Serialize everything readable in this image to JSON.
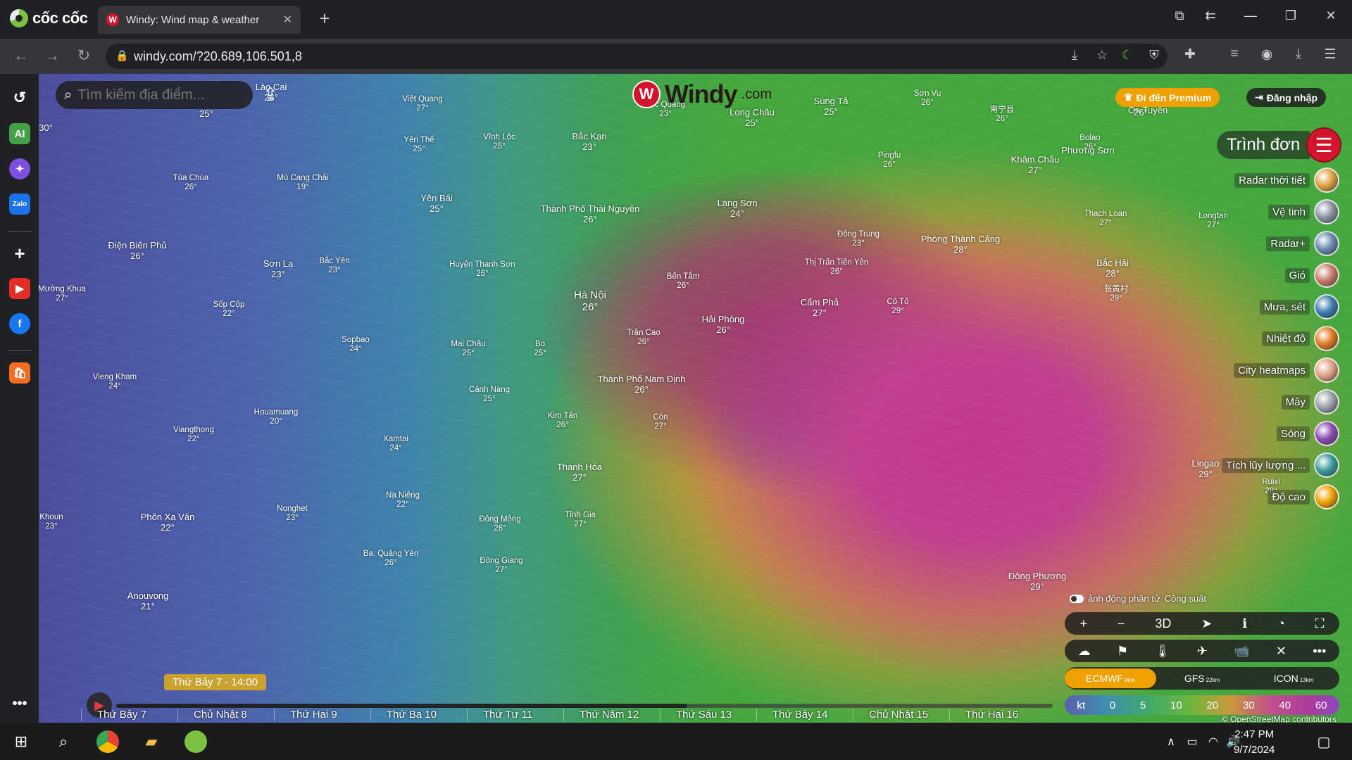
{
  "browser": {
    "brand": "cốc cốc",
    "tab_title": "Windy: Wind map & weather",
    "tab_favicon": "windy-logo-icon",
    "url": "windy.com/?20.689,106.501,8"
  },
  "map": {
    "search_placeholder": "Tìm kiếm địa điểm...",
    "logo_word": "Windy",
    "logo_suffix": ".com",
    "premium_label": "Đi đến Premium",
    "login_label": "Đăng nhập",
    "menu_label": "Trình đơn",
    "layers": [
      {
        "label": "Radar thời tiết",
        "color": "#e0a040"
      },
      {
        "label": "Vệ tinh",
        "color": "#8a94a0"
      },
      {
        "label": "Radar+",
        "color": "#6a8ab0"
      },
      {
        "label": "Gió",
        "color": "#c87a6a"
      },
      {
        "label": "Mưa, sét",
        "color": "#3a7ab0"
      },
      {
        "label": "Nhiệt độ",
        "color": "#e07a20"
      },
      {
        "label": "City heatmaps",
        "color": "#e0a080"
      },
      {
        "label": "Mây",
        "color": "#9aa0a8"
      },
      {
        "label": "Sóng",
        "color": "#8a4ab0"
      },
      {
        "label": "Tích lũy lượng ...",
        "color": "#3a9a9a"
      },
      {
        "label": "Độ cao",
        "color": "#f0a000"
      }
    ],
    "animation_label": "ảnh động phân tử",
    "hidden_label": "Công suất",
    "controls_row1": [
      "+",
      "−",
      "3D",
      "➤",
      "ℹ",
      "◔",
      "⛶"
    ],
    "controls_row2": [
      "☁",
      "⚑",
      "🌡",
      "✈",
      "📹",
      "✕",
      "•••"
    ],
    "models": [
      {
        "name": "ECMWF",
        "res": "9km",
        "active": true
      },
      {
        "name": "GFS",
        "res": "22km",
        "active": false
      },
      {
        "name": "ICON",
        "res": "13km",
        "active": false
      }
    ],
    "scale": [
      "kt",
      "0",
      "5",
      "10",
      "20",
      "30",
      "40",
      "60"
    ],
    "attribution": "© OpenStreetMap contributors",
    "current_time": "Thứ Bảy 7 - 14:00",
    "timeline_progress": 0.61,
    "days": [
      "Thứ Bảy 7",
      "Chủ Nhật 8",
      "Thứ Hai 9",
      "Thứ Ba 10",
      "Thứ Tư 11",
      "Thứ Năm 12",
      "Thứ Sáu 13",
      "Thứ Bảy 14",
      "Chủ Nhật 15",
      "Thứ Hai 16"
    ],
    "cities": [
      {
        "name": "Lào Cai",
        "temp": "26°",
        "size": "normal"
      },
      {
        "name": "Việt Quang",
        "temp": "27°",
        "size": "small"
      },
      {
        "name": "Lục Quang",
        "temp": "23°",
        "size": "small"
      },
      {
        "name": "Long Châu",
        "temp": "25°",
        "size": "normal"
      },
      {
        "name": "Sùng Tả",
        "temp": "25°",
        "size": "normal"
      },
      {
        "name": "Sơn Vu",
        "temp": "26°",
        "size": "small"
      },
      {
        "name": "南宁县",
        "temp": "26°",
        "size": "small"
      },
      {
        "name": "Ôn Tuyền",
        "temp": "",
        "size": "normal"
      },
      {
        "name": "Phương Sơn",
        "temp": "",
        "size": "normal"
      },
      {
        "name": "",
        "temp": "26°",
        "size": "normal"
      },
      {
        "name": "",
        "temp": "25°",
        "size": "normal"
      },
      {
        "name": "",
        "temp": "30°",
        "size": "normal"
      },
      {
        "name": "Yên Thế",
        "temp": "25°",
        "size": "small"
      },
      {
        "name": "Vĩnh Lộc",
        "temp": "25°",
        "size": "small"
      },
      {
        "name": "Bắc Kạn",
        "temp": "23°",
        "size": "normal"
      },
      {
        "name": "Pingfu",
        "temp": "26°",
        "size": "small"
      },
      {
        "name": "Bolao",
        "temp": "26°",
        "size": "small"
      },
      {
        "name": "Khâm Châu",
        "temp": "27°",
        "size": "normal"
      },
      {
        "name": "Tủa Chùa",
        "temp": "26°",
        "size": "small"
      },
      {
        "name": "Mù Cang Chải",
        "temp": "19°",
        "size": "small"
      },
      {
        "name": "Yên Bái",
        "temp": "25°",
        "size": "normal"
      },
      {
        "name": "Lạng Sơn",
        "temp": "24°",
        "size": "normal"
      },
      {
        "name": "Thạch Loan",
        "temp": "27°",
        "size": "small"
      },
      {
        "name": "Longtan",
        "temp": "27°",
        "size": "small"
      },
      {
        "name": "Thành Phố Thái Nguyên",
        "temp": "26°",
        "size": "normal"
      },
      {
        "name": "Đông Trung",
        "temp": "23°",
        "size": "small"
      },
      {
        "name": "Phòng Thành Cảng",
        "temp": "28°",
        "size": "normal"
      },
      {
        "name": "Điện Biên Phủ",
        "temp": "26°",
        "size": "normal"
      },
      {
        "name": "Sơn La",
        "temp": "23°",
        "size": "normal"
      },
      {
        "name": "Bắc Hải",
        "temp": "28°",
        "size": "normal"
      },
      {
        "name": "Bắc Yên",
        "temp": "23°",
        "size": "small"
      },
      {
        "name": "Huyện Thanh Sơn",
        "temp": "26°",
        "size": "small"
      },
      {
        "name": "Thị Trấn Tiên Yên",
        "temp": "26°",
        "size": "small"
      },
      {
        "name": "Bến Tắm",
        "temp": "26°",
        "size": "small"
      },
      {
        "name": "Mường Khua",
        "temp": "27°",
        "size": "small"
      },
      {
        "name": "Hà Nội",
        "temp": "26°",
        "size": "big"
      },
      {
        "name": "Cẩm Phả",
        "temp": "27°",
        "size": "normal"
      },
      {
        "name": "Cô Tô",
        "temp": "29°",
        "size": "small"
      },
      {
        "name": "张黄村",
        "temp": "29°",
        "size": "small"
      },
      {
        "name": "Sốp Cộp",
        "temp": "22°",
        "size": "small"
      },
      {
        "name": "Hải Phòng",
        "temp": "26°",
        "size": "normal"
      },
      {
        "name": "Trần Cao",
        "temp": "26°",
        "size": "small"
      },
      {
        "name": "Sopbao",
        "temp": "24°",
        "size": "small"
      },
      {
        "name": "Mai Châu",
        "temp": "25°",
        "size": "small"
      },
      {
        "name": "Bo",
        "temp": "25°",
        "size": "small"
      },
      {
        "name": "Vieng Kham",
        "temp": "24°",
        "size": "small"
      },
      {
        "name": "Thành Phố Nam Định",
        "temp": "26°",
        "size": "normal"
      },
      {
        "name": "Cảnh Nàng",
        "temp": "25°",
        "size": "small"
      },
      {
        "name": "Houamuang",
        "temp": "20°",
        "size": "small"
      },
      {
        "name": "Kim Tân",
        "temp": "26°",
        "size": "small"
      },
      {
        "name": "Còn",
        "temp": "27°",
        "size": "small"
      },
      {
        "name": "Viangthong",
        "temp": "22°",
        "size": "small"
      },
      {
        "name": "Xamtai",
        "temp": "24°",
        "size": "small"
      },
      {
        "name": "Thanh Hóa",
        "temp": "27°",
        "size": "normal"
      },
      {
        "name": "Lingao",
        "temp": "29°",
        "size": "normal"
      },
      {
        "name": "Ruixi",
        "temp": "28°",
        "size": "small"
      },
      {
        "name": "Na Niêng",
        "temp": "22°",
        "size": "small"
      },
      {
        "name": "Nonghet",
        "temp": "23°",
        "size": "small"
      },
      {
        "name": "Phôn Xa Văn",
        "temp": "22°",
        "size": "normal"
      },
      {
        "name": "Đông Mông",
        "temp": "26°",
        "size": "small"
      },
      {
        "name": "Tĩnh Gia",
        "temp": "27°",
        "size": "small"
      },
      {
        "name": "Khoun",
        "temp": "23°",
        "size": "small"
      },
      {
        "name": "Ba. Quảng Yên",
        "temp": "26°",
        "size": "small"
      },
      {
        "name": "Đông Giang",
        "temp": "27°",
        "size": "small"
      },
      {
        "name": "Đông Phương",
        "temp": "29°",
        "size": "normal"
      },
      {
        "name": "Anouvong",
        "temp": "21°",
        "size": "normal"
      }
    ]
  },
  "taskbar": {
    "time": "2:47 PM",
    "date": "9/7/2024"
  }
}
